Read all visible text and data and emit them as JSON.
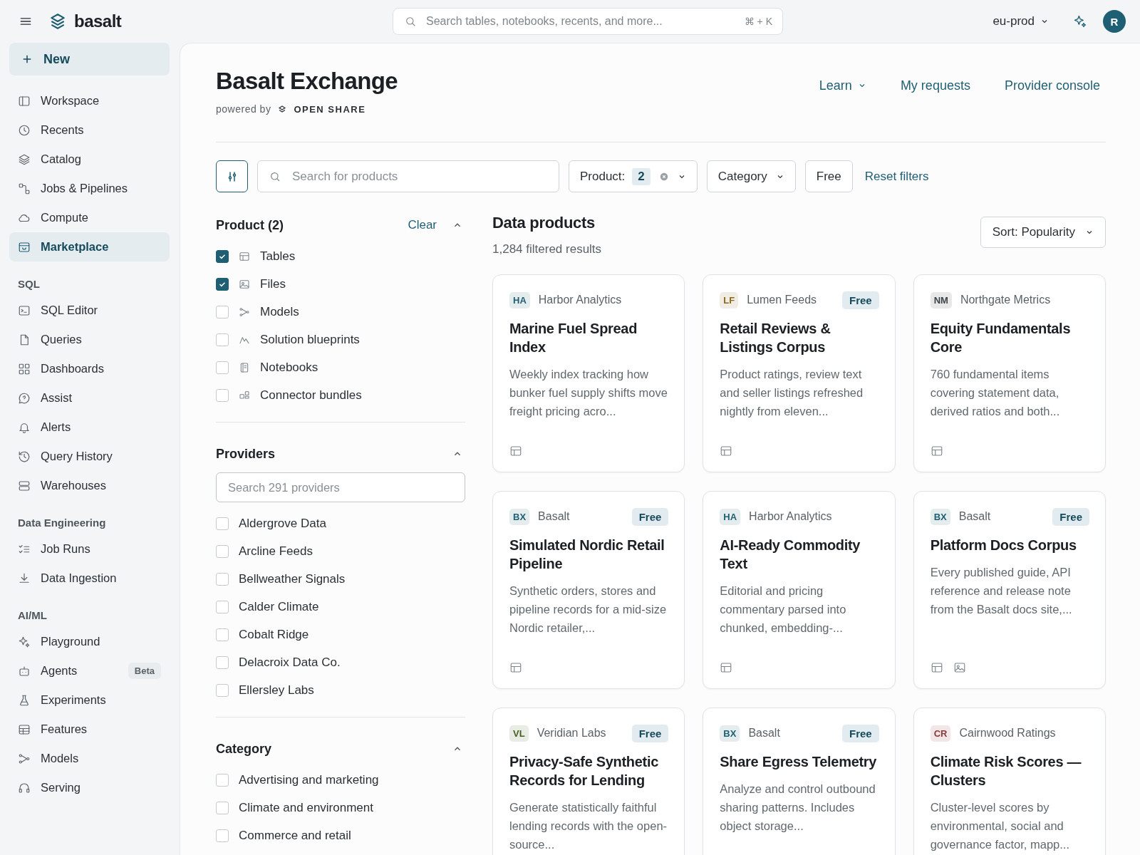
{
  "app": {
    "name": "basalt"
  },
  "search": {
    "placeholder": "Search tables, notebooks, recents, and more...",
    "shortcut": "⌘ + K"
  },
  "environment": "eu-prod",
  "user": {
    "initial": "R"
  },
  "sidebar": {
    "new_button": "New",
    "groups": [
      {
        "items": [
          {
            "label": "Workspace",
            "selected": false
          },
          {
            "label": "Recents",
            "selected": false
          },
          {
            "label": "Catalog",
            "selected": false
          },
          {
            "label": "Jobs & Pipelines",
            "selected": false
          },
          {
            "label": "Compute",
            "selected": false
          },
          {
            "label": "Marketplace",
            "selected": true
          }
        ]
      },
      {
        "title": "SQL",
        "items": [
          {
            "label": "SQL Editor",
            "selected": false
          },
          {
            "label": "Queries",
            "selected": false
          },
          {
            "label": "Dashboards",
            "selected": false
          },
          {
            "label": "Assist",
            "selected": false
          },
          {
            "label": "Alerts",
            "selected": false
          },
          {
            "label": "Query History",
            "selected": false
          },
          {
            "label": "Warehouses",
            "selected": false
          }
        ]
      },
      {
        "title": "Data Engineering",
        "items": [
          {
            "label": "Job Runs",
            "selected": false
          },
          {
            "label": "Data Ingestion",
            "selected": false
          }
        ]
      },
      {
        "title": "AI/ML",
        "items": [
          {
            "label": "Playground",
            "selected": false
          },
          {
            "label": "Agents",
            "selected": false,
            "badge": "Beta"
          },
          {
            "label": "Experiments",
            "selected": false
          },
          {
            "label": "Features",
            "selected": false
          },
          {
            "label": "Models",
            "selected": false
          },
          {
            "label": "Serving",
            "selected": false
          }
        ]
      }
    ]
  },
  "header": {
    "title": "Basalt Exchange",
    "powered_by": "powered by",
    "partner": "OPEN SHARE",
    "links": [
      {
        "label": "Learn",
        "dropdown": true
      },
      {
        "label": "My requests",
        "dropdown": false
      },
      {
        "label": "Provider console",
        "dropdown": false
      }
    ]
  },
  "filter_bar": {
    "search_placeholder": "Search for products",
    "product_filter": {
      "label": "Product:",
      "count": "2"
    },
    "category_filter": "Category",
    "free_filter": "Free",
    "reset": "Reset filters"
  },
  "facets": [
    {
      "title": "Product (2)",
      "clear": "Clear",
      "expanded": true,
      "options": [
        {
          "label": "Tables",
          "checked": true
        },
        {
          "label": "Files",
          "checked": true
        },
        {
          "label": "Models",
          "checked": false
        },
        {
          "label": "Solution blueprints",
          "checked": false
        },
        {
          "label": "Notebooks",
          "checked": false
        },
        {
          "label": "Connector bundles",
          "checked": false
        }
      ]
    },
    {
      "title": "Providers",
      "expanded": true,
      "search_placeholder": "Search 291 providers",
      "options": [
        {
          "label": "Aldergrove Data",
          "checked": false
        },
        {
          "label": "Arcline Feeds",
          "checked": false
        },
        {
          "label": "Bellweather Signals",
          "checked": false
        },
        {
          "label": "Calder Climate",
          "checked": false
        },
        {
          "label": "Cobalt Ridge",
          "checked": false
        },
        {
          "label": "Delacroix Data Co.",
          "checked": false
        },
        {
          "label": "Ellersley Labs",
          "checked": false
        }
      ]
    },
    {
      "title": "Category",
      "expanded": true,
      "options": [
        {
          "label": "Advertising and marketing",
          "checked": false
        },
        {
          "label": "Climate and environment",
          "checked": false
        },
        {
          "label": "Commerce and retail",
          "checked": false
        }
      ]
    }
  ],
  "results": {
    "title": "Data products",
    "count": "1,284 filtered results",
    "sort": "Sort: Popularity",
    "cards": [
      {
        "initials": "HA",
        "color": "#1f5f73",
        "provider": "Harbor Analytics",
        "title": "Marine Fuel Spread Index",
        "description": "Weekly index tracking how bunker fuel supply shifts move freight pricing acro...",
        "formats": [
          {
            "kind": "table"
          }
        ]
      },
      {
        "initials": "LF",
        "color": "#8a6a1f",
        "provider": "Lumen Feeds",
        "badge": "Free",
        "title": "Retail Reviews & Listings Corpus",
        "description": "Product ratings, review text and seller listings refreshed nightly from eleven...",
        "formats": [
          {
            "kind": "table"
          }
        ]
      },
      {
        "initials": "NM",
        "color": "#3c4348",
        "provider": "Northgate Metrics",
        "title": "Equity Fundamentals Core",
        "description": "760 fundamental items covering statement data, derived ratios and both...",
        "formats": [
          {
            "kind": "table"
          }
        ]
      },
      {
        "initials": "BX",
        "color": "#1f5f73",
        "provider": "Basalt",
        "badge": "Free",
        "title": "Simulated Nordic Retail Pipeline",
        "description": "Synthetic orders, stores and pipeline records for a mid-size Nordic retailer,...",
        "formats": [
          {
            "kind": "table"
          }
        ]
      },
      {
        "initials": "HA",
        "color": "#1f5f73",
        "provider": "Harbor Analytics",
        "title": "AI-Ready Commodity Text",
        "description": "Editorial and pricing commentary parsed into chunked, embedding-...",
        "formats": [
          {
            "kind": "table"
          }
        ]
      },
      {
        "initials": "BX",
        "color": "#1f5f73",
        "provider": "Basalt",
        "badge": "Free",
        "title": "Platform Docs Corpus",
        "description": "Every published guide, API reference and release note from the Basalt docs site,...",
        "formats": [
          {
            "kind": "table"
          },
          {
            "kind": "image"
          }
        ]
      },
      {
        "initials": "VL",
        "color": "#4a5d23",
        "provider": "Veridian Labs",
        "badge": "Free",
        "title": "Privacy-Safe Synthetic Records for Lending",
        "description": "Generate statistically faithful lending records with the open-source..."
      },
      {
        "initials": "BX",
        "color": "#1f5f73",
        "provider": "Basalt",
        "badge": "Free",
        "title": "Share Egress Telemetry",
        "description": "Analyze and control outbound sharing patterns. Includes object storage..."
      },
      {
        "initials": "CR",
        "color": "#8b3a3a",
        "provider": "Cairnwood Ratings",
        "title": "Climate Risk Scores — Clusters",
        "description": "Cluster-level scores by environmental, social and governance factor, mapp..."
      }
    ]
  }
}
